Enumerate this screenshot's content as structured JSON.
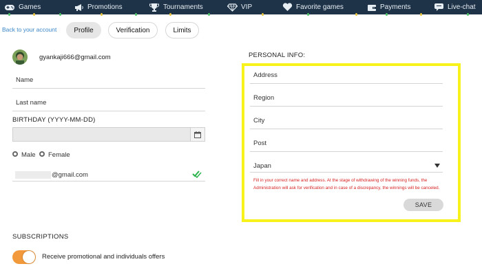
{
  "nav": {
    "items": [
      {
        "label": "Games",
        "icon": "gamepad-icon"
      },
      {
        "label": "Promotions",
        "icon": "megaphone-icon"
      },
      {
        "label": "Tournaments",
        "icon": "trophy-icon"
      },
      {
        "label": "VIP",
        "icon": "diamond-icon"
      },
      {
        "label": "Favorite games",
        "icon": "heart-icon"
      },
      {
        "label": "Payments",
        "icon": "wallet-icon"
      },
      {
        "label": "Live-chat",
        "icon": "chat-icon"
      }
    ],
    "background": "#1f3348"
  },
  "account": {
    "back_label": "Back to your account",
    "tabs": [
      "Profile",
      "Verification",
      "Limits"
    ],
    "active_tab": "Profile"
  },
  "profile": {
    "email": "gyankaji666@gmail.com",
    "name_label": "Name",
    "last_name_label": "Last name",
    "birthday_label": "BIRTHDAY (YYYY-MM-DD)",
    "gender_male": "Male",
    "gender_female": "Female",
    "email_suffix": "@gmail.com"
  },
  "personal": {
    "title": "PERSONAL INFO:",
    "address_label": "Address",
    "region_label": "Region",
    "city_label": "City",
    "post_label": "Post",
    "country_value": "Japan",
    "warning": "Fill in your correct name and address. At the stage of withdrawing of the winning funds, the Administration will ask for verification and in case of a discrepancy, the winnings will be canceled.",
    "save_label": "SAVE",
    "highlight_color": "#f6f21a",
    "warning_color": "#d61f1f"
  },
  "subscriptions": {
    "title": "SUBSCRIPTIONS",
    "promo_label": "Receive promotional and individuals offers",
    "promo_enabled": true,
    "toggle_color": "#f29a3b"
  }
}
